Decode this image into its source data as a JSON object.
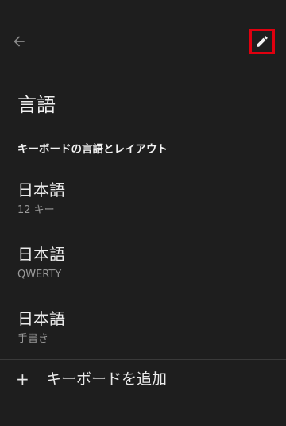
{
  "toolbar": {
    "back_icon": "arrow-left-icon",
    "edit_icon": "pencil-icon",
    "highlight_color": "#e0000f"
  },
  "page": {
    "title": "言語",
    "section_header": "キーボードの言語とレイアウト"
  },
  "languages": [
    {
      "name": "日本語",
      "layout": "12 キー"
    },
    {
      "name": "日本語",
      "layout": "QWERTY"
    },
    {
      "name": "日本語",
      "layout": "手書き"
    }
  ],
  "add_keyboard": {
    "plus": "+",
    "label": "キーボードを追加"
  }
}
